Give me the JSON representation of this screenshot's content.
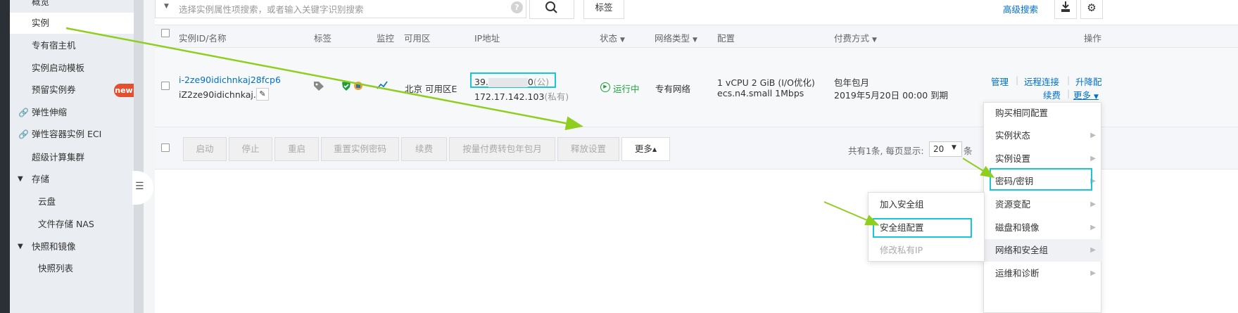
{
  "sidebar": {
    "items": [
      {
        "label": "概览"
      },
      {
        "label": "实例",
        "active": true
      },
      {
        "label": "专有宿主机"
      },
      {
        "label": "实例启动模板"
      },
      {
        "label": "预留实例券",
        "badge": "new"
      },
      {
        "label": "弹性伸缩",
        "icon": "link-icon"
      },
      {
        "label": "弹性容器实例 ECI",
        "icon": "link-icon"
      },
      {
        "label": "超级计算集群"
      },
      {
        "label": "存储",
        "section": true
      },
      {
        "label": "云盘",
        "sub": true
      },
      {
        "label": "文件存储 NAS",
        "sub": true
      },
      {
        "label": "快照和镜像",
        "section": true
      },
      {
        "label": "快照列表",
        "sub": true
      }
    ]
  },
  "toolbar": {
    "search_placeholder": "选择实例属性项搜索，或者输入关键字识别搜索",
    "help_icon": "?",
    "tag_label": "标签",
    "advanced_search": "高级搜索"
  },
  "table": {
    "headers": {
      "id_name": "实例ID/名称",
      "tags": "标签",
      "monitor": "监控",
      "zone": "可用区",
      "ip": "IP地址",
      "status": "状态",
      "network": "网络类型",
      "config": "配置",
      "billing": "付费方式",
      "ops": "操作"
    },
    "row": {
      "instance_id": "i-2ze90idichnkaj28fcp6",
      "instance_name": "iZ2ze90idichnkaj...",
      "zone": "北京 可用区E",
      "public_ip_prefix": "39.",
      "public_ip_suffix": "0",
      "public_tag": "(公)",
      "private_ip": "172.17.142.103",
      "private_tag": "(私有)",
      "status": "运行中",
      "network": "专有网络",
      "config_line1": "1 vCPU 2 GiB (I/O优化)",
      "config_line2": "ecs.n4.small   1Mbps",
      "billing_line1": "包年包月",
      "billing_line2": "2019年5月20日 00:00 到期",
      "op_manage": "管理",
      "op_remote": "远程连接",
      "op_upgrade": "升降配",
      "op_renew": "续费",
      "op_more": "更多"
    }
  },
  "actions": {
    "buttons": [
      "启动",
      "停止",
      "重启",
      "重置实例密码",
      "续费",
      "按量付费转包年包月",
      "释放设置"
    ],
    "more": "更多▴"
  },
  "pager": {
    "summary": "共有1条, 每页显示:",
    "page_size": "20",
    "unit": "条"
  },
  "more_menu": {
    "items": [
      {
        "label": "购买相同配置",
        "arrow": false
      },
      {
        "label": "实例状态",
        "arrow": true
      },
      {
        "label": "实例设置",
        "arrow": true
      },
      {
        "label": "密码/密钥",
        "arrow": true,
        "highlighted": true
      },
      {
        "label": "资源变配",
        "arrow": true
      },
      {
        "label": "磁盘和镜像",
        "arrow": true
      },
      {
        "label": "网络和安全组",
        "arrow": true,
        "hover": true
      },
      {
        "label": "运维和诊断",
        "arrow": true
      }
    ]
  },
  "sub_menu": {
    "items": [
      {
        "label": "加入安全组",
        "disabled": false
      },
      {
        "label": "安全组配置",
        "disabled": false,
        "highlighted": true
      },
      {
        "label": "修改私有IP",
        "disabled": true
      }
    ]
  },
  "colors": {
    "link": "#0070cc",
    "highlight": "#19c6d6",
    "arrow": "#8fce1e",
    "running": "#20a33c",
    "badge": "#e2502f"
  }
}
